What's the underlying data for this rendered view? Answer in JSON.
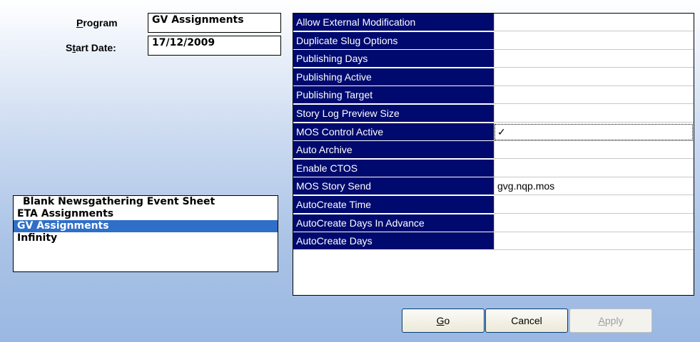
{
  "header": {
    "program_label_pre": "",
    "program_label_u": "P",
    "program_label_post": "rogram",
    "start_date_label_pre": "S",
    "start_date_label_u": "t",
    "start_date_label_post": "art Date:",
    "program_value": "GV Assignments",
    "start_date_value": "17/12/2009"
  },
  "program_list": {
    "items": [
      {
        "label": "Blank Newsgathering Event Sheet",
        "selected": false
      },
      {
        "label": "ETA Assignments",
        "selected": false
      },
      {
        "label": "GV Assignments",
        "selected": true
      },
      {
        "label": "Infinity",
        "selected": false
      }
    ]
  },
  "properties": [
    {
      "name": "Allow External Modification",
      "value": ""
    },
    {
      "name": "Duplicate Slug Options",
      "value": ""
    },
    {
      "name": "Publishing Days",
      "value": ""
    },
    {
      "name": "Publishing Active",
      "value": ""
    },
    {
      "name": "Publishing Target",
      "value": ""
    },
    {
      "name": "Story Log Preview Size",
      "value": ""
    },
    {
      "name": "MOS Control Active",
      "value": "✓"
    },
    {
      "name": "Auto Archive",
      "value": ""
    },
    {
      "name": "Enable CTOS",
      "value": ""
    },
    {
      "name": "MOS Story Send",
      "value": "gvg.nqp.mos"
    },
    {
      "name": "AutoCreate Time",
      "value": ""
    },
    {
      "name": "AutoCreate Days In Advance",
      "value": ""
    },
    {
      "name": "AutoCreate Days",
      "value": ""
    }
  ],
  "buttons": {
    "go_u": "G",
    "go_rest": "o",
    "cancel": "Cancel",
    "apply_u": "A",
    "apply_rest": "pply"
  },
  "colors": {
    "property_name_bg": "#000a6e",
    "selection_bg": "#2f6fc7"
  }
}
